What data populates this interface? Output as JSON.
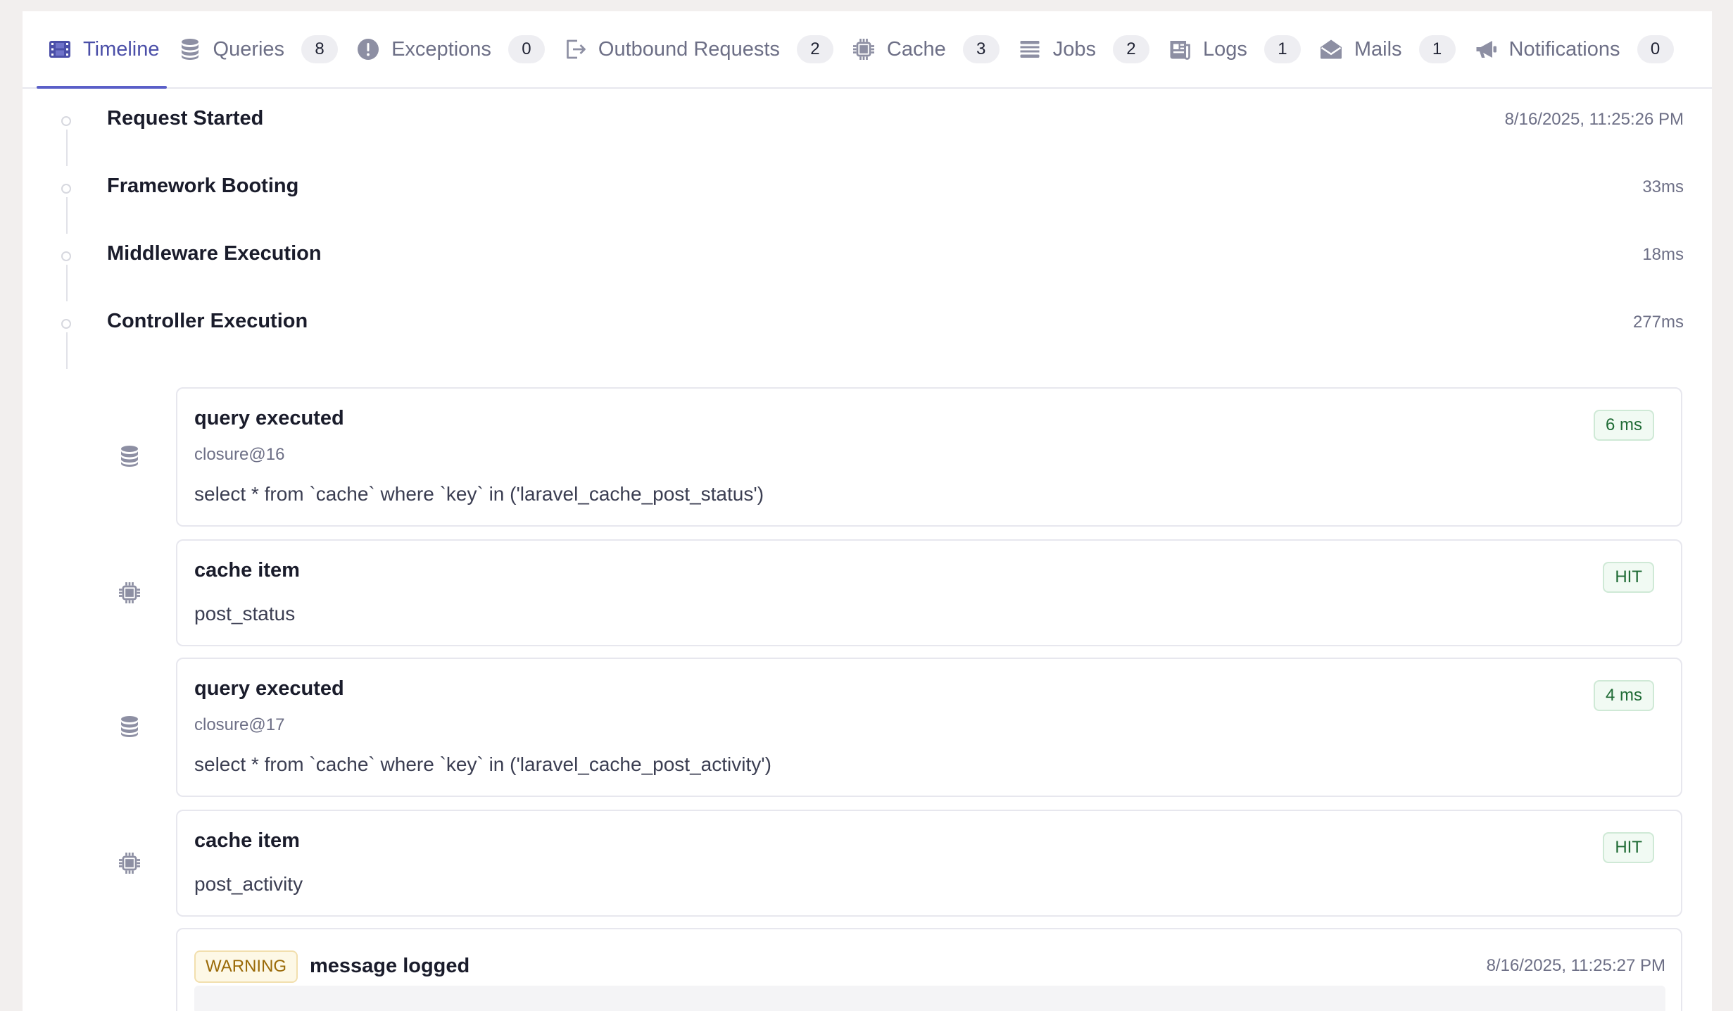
{
  "tabs": [
    {
      "label": "Timeline",
      "count": null,
      "icon": "film-icon"
    },
    {
      "label": "Queries",
      "count": "8",
      "icon": "database-icon"
    },
    {
      "label": "Exceptions",
      "count": "0",
      "icon": "exclamation-icon"
    },
    {
      "label": "Outbound Requests",
      "count": "2",
      "icon": "exit-icon"
    },
    {
      "label": "Cache",
      "count": "3",
      "icon": "chip-icon"
    },
    {
      "label": "Jobs",
      "count": "2",
      "icon": "queue-icon"
    },
    {
      "label": "Logs",
      "count": "1",
      "icon": "newspaper-icon"
    },
    {
      "label": "Mails",
      "count": "1",
      "icon": "envelope-open-icon"
    },
    {
      "label": "Notifications",
      "count": "0",
      "icon": "megaphone-icon"
    }
  ],
  "stages": [
    {
      "title": "Request Started",
      "meta": "8/16/2025, 11:25:26 PM"
    },
    {
      "title": "Framework Booting",
      "meta": "33ms"
    },
    {
      "title": "Middleware Execution",
      "meta": "18ms"
    },
    {
      "title": "Controller Execution",
      "meta": "277ms"
    }
  ],
  "events": [
    {
      "type": "query",
      "icon": "database-icon",
      "title": "query executed",
      "sub": "closure@16",
      "body": "select * from `cache` where `key` in ('laravel_cache_post_status')",
      "badge": "6 ms"
    },
    {
      "type": "cache",
      "icon": "chip-icon",
      "title": "cache item",
      "body": "post_status",
      "badge": "HIT"
    },
    {
      "type": "query",
      "icon": "database-icon",
      "title": "query executed",
      "sub": "closure@17",
      "body": "select * from `cache` where `key` in ('laravel_cache_post_activity')",
      "badge": "4 ms"
    },
    {
      "type": "cache",
      "icon": "chip-icon",
      "title": "cache item",
      "body": "post_activity",
      "badge": "HIT"
    }
  ],
  "log": {
    "level": "WARNING",
    "message": "message logged",
    "time": "8/16/2025, 11:25:27 PM"
  },
  "colors": {
    "accent": "#4b4fa8",
    "hit_green": "#1f6b35",
    "warning": "#9a6a08"
  }
}
